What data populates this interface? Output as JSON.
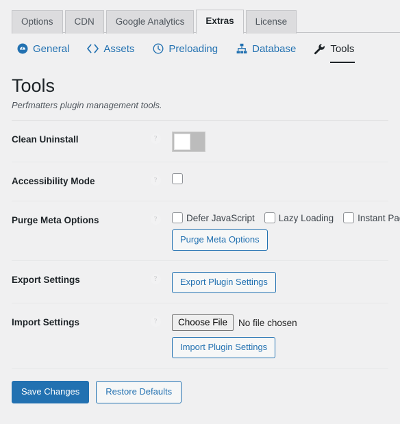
{
  "tabs": [
    {
      "label": "Options",
      "active": false
    },
    {
      "label": "CDN",
      "active": false
    },
    {
      "label": "Google Analytics",
      "active": false
    },
    {
      "label": "Extras",
      "active": true
    },
    {
      "label": "License",
      "active": false
    }
  ],
  "subnav": [
    {
      "label": "General",
      "icon": "speedometer-icon",
      "current": false
    },
    {
      "label": "Assets",
      "icon": "code-brackets-icon",
      "current": false
    },
    {
      "label": "Preloading",
      "icon": "clock-icon",
      "current": false
    },
    {
      "label": "Database",
      "icon": "sitemap-icon",
      "current": false
    },
    {
      "label": "Tools",
      "icon": "wrench-icon",
      "current": true
    }
  ],
  "page": {
    "title": "Tools",
    "subtitle": "Perfmatters plugin management tools.",
    "help_glyph": "?"
  },
  "rows": {
    "clean_uninstall": {
      "label": "Clean Uninstall",
      "toggle_state": "off"
    },
    "accessibility_mode": {
      "label": "Accessibility Mode",
      "checked": false
    },
    "purge_meta": {
      "label": "Purge Meta Options",
      "checkboxes": [
        {
          "label": "Defer JavaScript",
          "checked": false
        },
        {
          "label": "Lazy Loading",
          "checked": false
        },
        {
          "label": "Instant Page",
          "checked": false
        }
      ],
      "button_label": "Purge Meta Options"
    },
    "export_settings": {
      "label": "Export Settings",
      "button_label": "Export Plugin Settings"
    },
    "import_settings": {
      "label": "Import Settings",
      "file_button_label": "Choose File",
      "file_status": "No file chosen",
      "button_label": "Import Plugin Settings"
    }
  },
  "footer": {
    "save_label": "Save Changes",
    "restore_label": "Restore Defaults"
  },
  "colors": {
    "accent_blue": "#2271b1",
    "background": "#f0f0f1",
    "tab_inactive": "#dcdcde",
    "border": "#c3c4c7",
    "text_dark": "#1d2327"
  }
}
